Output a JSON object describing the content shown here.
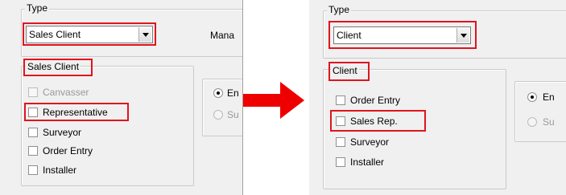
{
  "before": {
    "type_group": {
      "label": "Type",
      "selected": "Sales Client"
    },
    "partial_label": "Mana",
    "client_group": {
      "label": "Sales Client",
      "checkboxes": [
        {
          "label": "Canvasser",
          "checked": false,
          "enabled": false
        },
        {
          "label": "Representative",
          "checked": false,
          "enabled": true,
          "highlighted": true
        },
        {
          "label": "Surveyor",
          "checked": false,
          "enabled": true
        },
        {
          "label": "Order Entry",
          "checked": false,
          "enabled": true
        },
        {
          "label": "Installer",
          "checked": false,
          "enabled": true
        }
      ]
    },
    "radios": [
      {
        "label": "En",
        "selected": true,
        "enabled": true
      },
      {
        "label": "Su",
        "selected": false,
        "enabled": false
      }
    ]
  },
  "after": {
    "type_group": {
      "label": "Type",
      "selected": "Client"
    },
    "client_group": {
      "label": "Client",
      "checkboxes": [
        {
          "label": "Order Entry",
          "checked": false,
          "enabled": true
        },
        {
          "label": "Sales Rep.",
          "checked": false,
          "enabled": true,
          "highlighted": true
        },
        {
          "label": "Surveyor",
          "checked": false,
          "enabled": true
        },
        {
          "label": "Installer",
          "checked": false,
          "enabled": true
        }
      ]
    },
    "radios": [
      {
        "label": "En",
        "selected": true,
        "enabled": true
      },
      {
        "label": "Su",
        "selected": false,
        "enabled": false
      }
    ]
  },
  "colors": {
    "highlight": "#e0141e",
    "window_bg": "#f0f0f0",
    "arrow": "#ee0000"
  },
  "icons": [
    "dropdown-arrow-icon",
    "right-arrow-icon"
  ]
}
